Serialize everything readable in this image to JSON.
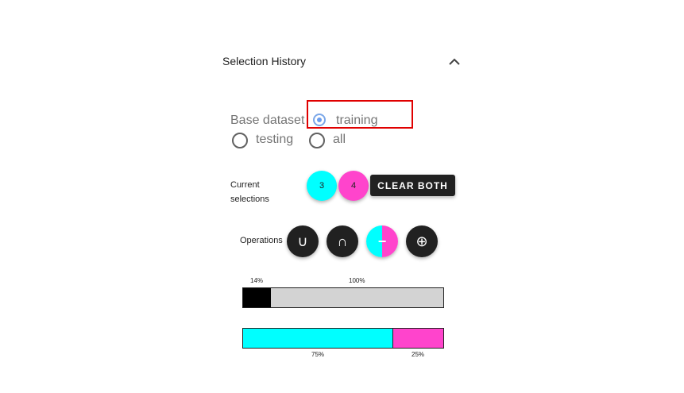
{
  "panel": {
    "title": "Selection History"
  },
  "base_dataset": {
    "label": "Base dataset",
    "options": [
      {
        "label": "training",
        "selected": true
      },
      {
        "label": "testing",
        "selected": false
      },
      {
        "label": "all",
        "selected": false
      }
    ]
  },
  "current_selections": {
    "label": "Current selections",
    "chips": [
      {
        "label": "3",
        "color": "#00ffff"
      },
      {
        "label": "4",
        "color": "#ff44cc"
      }
    ],
    "clear_label": "CLEAR BOTH"
  },
  "operations": {
    "label": "Operations",
    "buttons": [
      {
        "name": "union",
        "symbol": "∪"
      },
      {
        "name": "intersection",
        "symbol": "∩"
      },
      {
        "name": "difference",
        "symbol": "−"
      },
      {
        "name": "symmetric-difference",
        "symbol": "⊕"
      }
    ]
  },
  "coverage_bar": {
    "fill_fraction": 0.14,
    "fill_label": "14%",
    "total_label": "100%",
    "fill_color": "#000000",
    "rest_color": "#d3d3d3"
  },
  "split_bar": {
    "first_fraction": 0.75,
    "first_label": "75%",
    "second_label": "25%",
    "first_color": "#00ffff",
    "second_color": "#ff44cc"
  }
}
